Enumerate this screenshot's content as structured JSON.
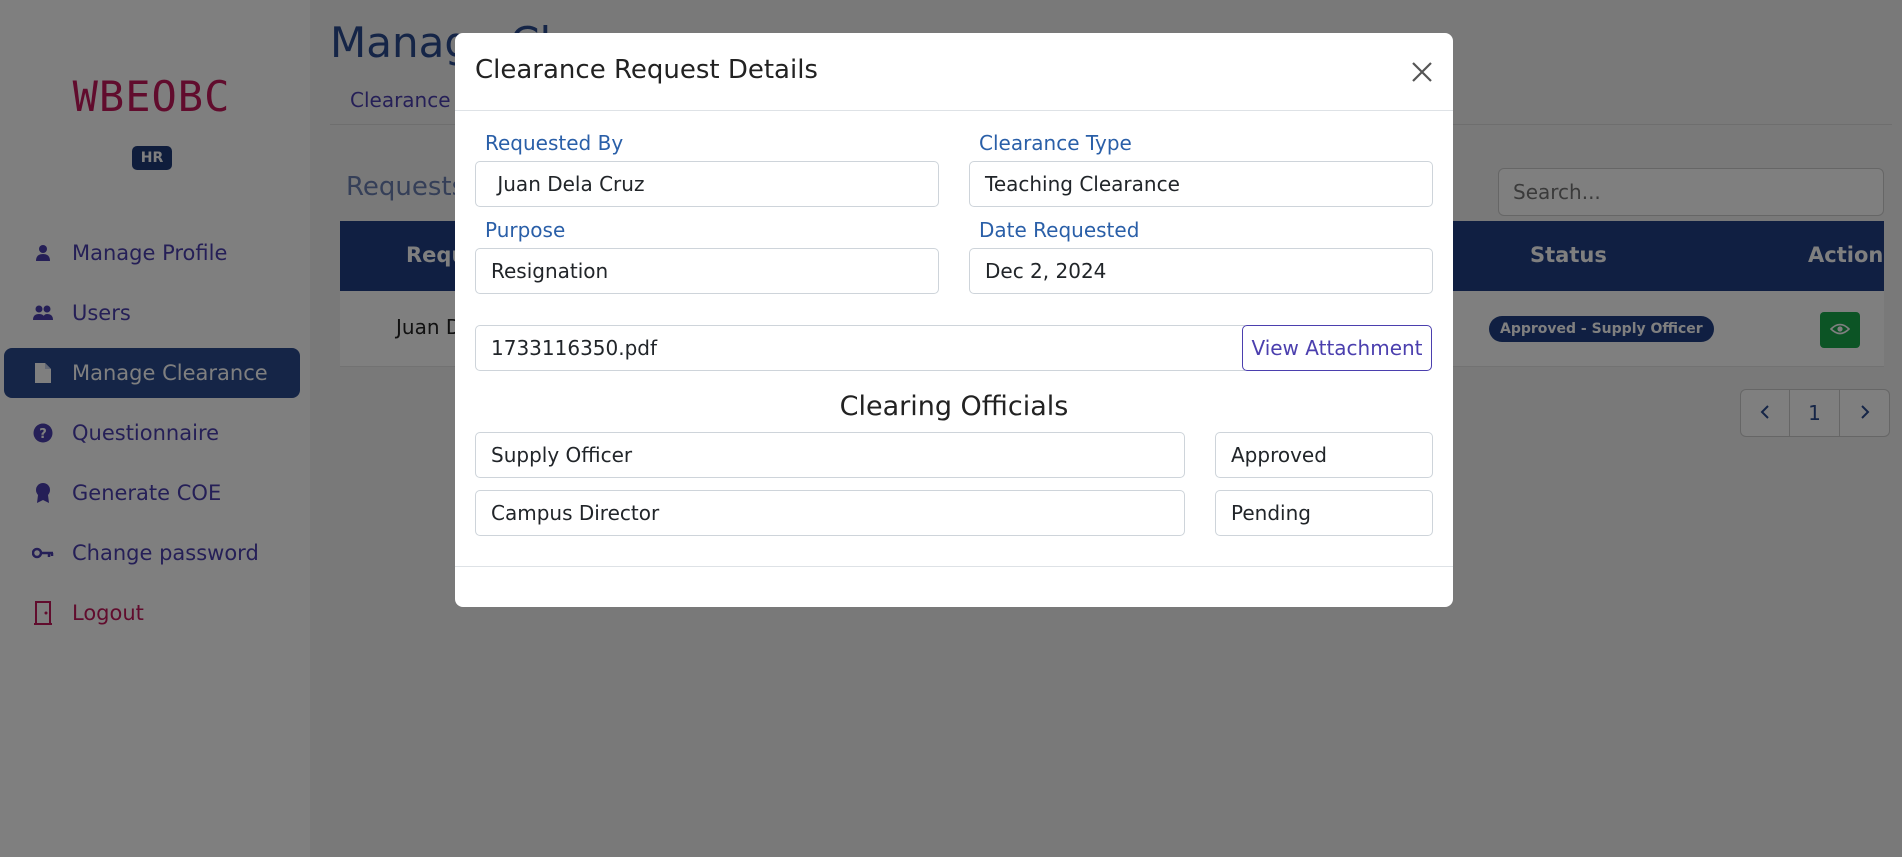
{
  "sidebar": {
    "brand": "WBEOBC",
    "role_badge": "HR",
    "items": [
      {
        "label": "Manage Profile",
        "icon": "user-icon"
      },
      {
        "label": "Users",
        "icon": "users-icon"
      },
      {
        "label": "Manage Clearance",
        "icon": "document-icon",
        "active": true
      },
      {
        "label": "Questionnaire",
        "icon": "question-circle-icon"
      },
      {
        "label": "Generate COE",
        "icon": "award-icon"
      },
      {
        "label": "Change password",
        "icon": "key-icon"
      }
    ],
    "logout_label": "Logout"
  },
  "main": {
    "page_title": "Manage Cl",
    "subtab": "Clearance R",
    "section_title": "Requests",
    "search_placeholder": "Search...",
    "table": {
      "headers": {
        "requested_by": "Reque",
        "status": "Status",
        "action": "Action"
      },
      "rows": [
        {
          "name": "Juan D",
          "status": "Approved - Supply Officer"
        }
      ]
    },
    "pagination": {
      "current_page": "1"
    }
  },
  "modal": {
    "title": "Clearance Request Details",
    "requested_by_label": "Requested By",
    "requested_by_value": " Juan Dela Cruz",
    "clearance_type_label": "Clearance Type",
    "clearance_type_value": "Teaching Clearance",
    "purpose_label": "Purpose",
    "purpose_value": "Resignation",
    "date_requested_label": "Date Requested",
    "date_requested_value": "Dec 2, 2024",
    "attachment_filename": "1733116350.pdf",
    "view_attachment_label": "View Attachment",
    "clearing_officials_title": "Clearing Officials",
    "officials": [
      {
        "name": "Supply Officer",
        "status": "Approved"
      },
      {
        "name": "Campus Director",
        "status": "Pending"
      }
    ]
  },
  "colors": {
    "primary": "#213f85",
    "brand": "#c2185b",
    "nav_text": "#4b3fae",
    "view_button": "#19a84a"
  }
}
